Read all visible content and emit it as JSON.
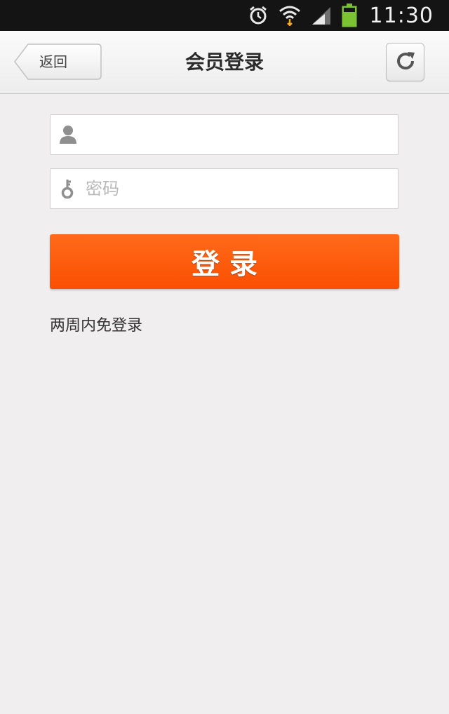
{
  "status_bar": {
    "time": "11:30",
    "icons": [
      "alarm-icon",
      "wifi-icon",
      "signal-icon",
      "battery-icon"
    ],
    "battery_color": "#7cc334"
  },
  "header": {
    "back_label": "返回",
    "title": "会员登录",
    "refresh_icon": "refresh-icon"
  },
  "form": {
    "username": {
      "value": "",
      "placeholder": "",
      "icon": "user-icon"
    },
    "password": {
      "value": "",
      "placeholder": "密码",
      "icon": "key-icon"
    },
    "login_label": "登录",
    "remember_label": "两周内免登录"
  },
  "colors": {
    "accent": "#fb4f02",
    "background": "#f0eeef",
    "status_bar": "#141414"
  }
}
